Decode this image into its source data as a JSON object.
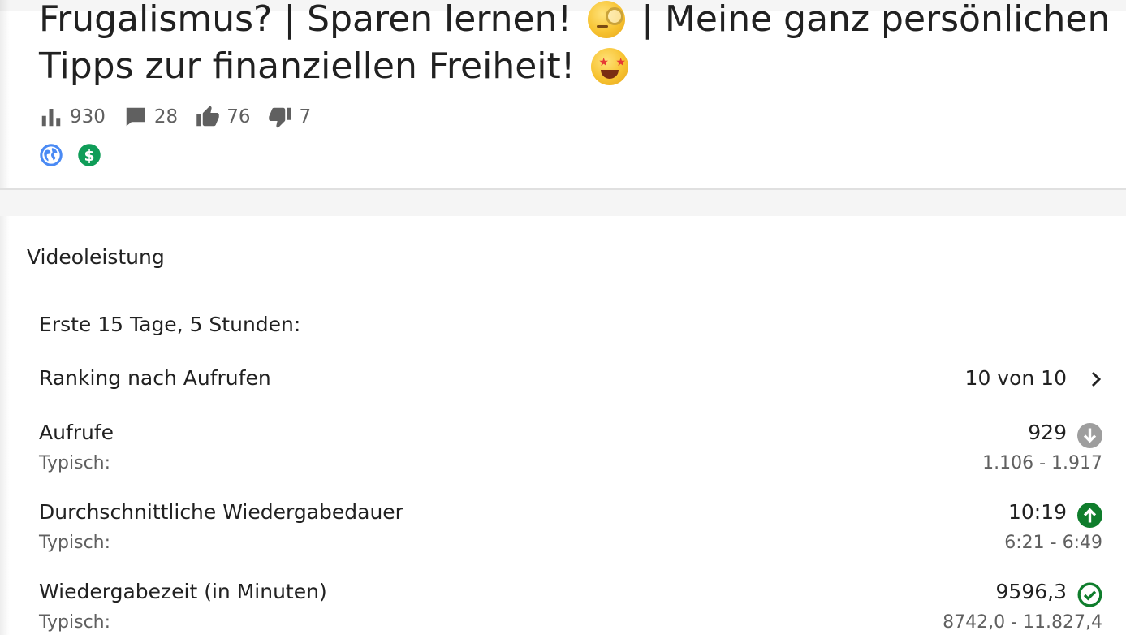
{
  "video": {
    "title_line1": "Frugalismus? | Sparen lernen!",
    "title_line1_end": "| Meine ganz persönlichen",
    "title_line2": "Tipps zur finanziellen Freiheit!",
    "stats": {
      "views": "930",
      "comments": "28",
      "likes": "76",
      "dislikes": "7"
    },
    "badges": [
      "globe-icon",
      "monetization-icon"
    ]
  },
  "performance": {
    "section_title": "Videoleistung",
    "period": "Erste 15 Tage, 5 Stunden:",
    "ranking": {
      "label": "Ranking nach Aufrufen",
      "value": "10 von 10"
    },
    "metrics": [
      {
        "label": "Aufrufe",
        "value": "929",
        "status_icon": "arrow-down-icon",
        "status_color": "#9e9e9e",
        "typical_label": "Typisch:",
        "typical_range": "1.106 - 1.917"
      },
      {
        "label": "Durchschnittliche Wiedergabedauer",
        "value": "10:19",
        "status_icon": "arrow-up-icon",
        "status_color": "#0f7d2c",
        "typical_label": "Typisch:",
        "typical_range": "6:21 - 6:49"
      },
      {
        "label": "Wiedergabezeit (in Minuten)",
        "value": "9596,3",
        "status_icon": "check-circle-icon",
        "status_color": "#0f7d2c",
        "typical_label": "Typisch:",
        "typical_range": "8742,0 - 11.827,4"
      }
    ]
  },
  "colors": {
    "text_primary": "#212121",
    "text_secondary": "#606060",
    "globe_blue": "#4a8af4",
    "dollar_green": "#0f9d58",
    "status_green": "#0f7d2c",
    "status_grey": "#9e9e9e"
  }
}
